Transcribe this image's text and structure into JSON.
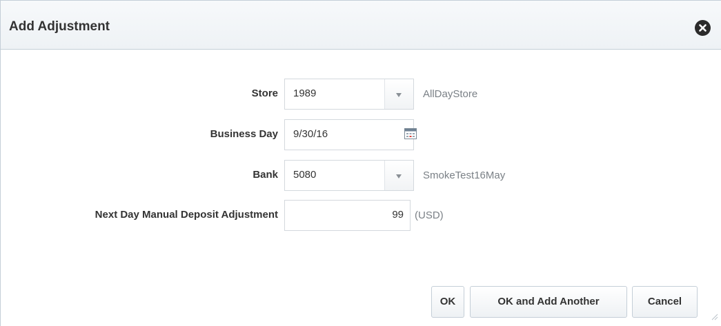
{
  "dialog": {
    "title": "Add Adjustment"
  },
  "form": {
    "store": {
      "label": "Store",
      "value": "1989",
      "description": "AllDayStore"
    },
    "business_day": {
      "label": "Business Day",
      "value": "9/30/16"
    },
    "bank": {
      "label": "Bank",
      "value": "5080",
      "description": "SmokeTest16May"
    },
    "adjustment": {
      "label": "Next Day Manual Deposit Adjustment",
      "value": "99",
      "currency": "(USD)"
    }
  },
  "buttons": {
    "ok": "OK",
    "ok_add_another": "OK and Add Another",
    "cancel": "Cancel"
  },
  "icons": {
    "close": "close-icon",
    "calendar": "calendar-icon",
    "dropdown": "chevron-down-icon",
    "resize": "resize-grip-icon"
  },
  "colors": {
    "accent_border": "#c4ced7",
    "title_bg": "#eef2f5",
    "text": "#333333",
    "muted_text": "#7a8086"
  }
}
